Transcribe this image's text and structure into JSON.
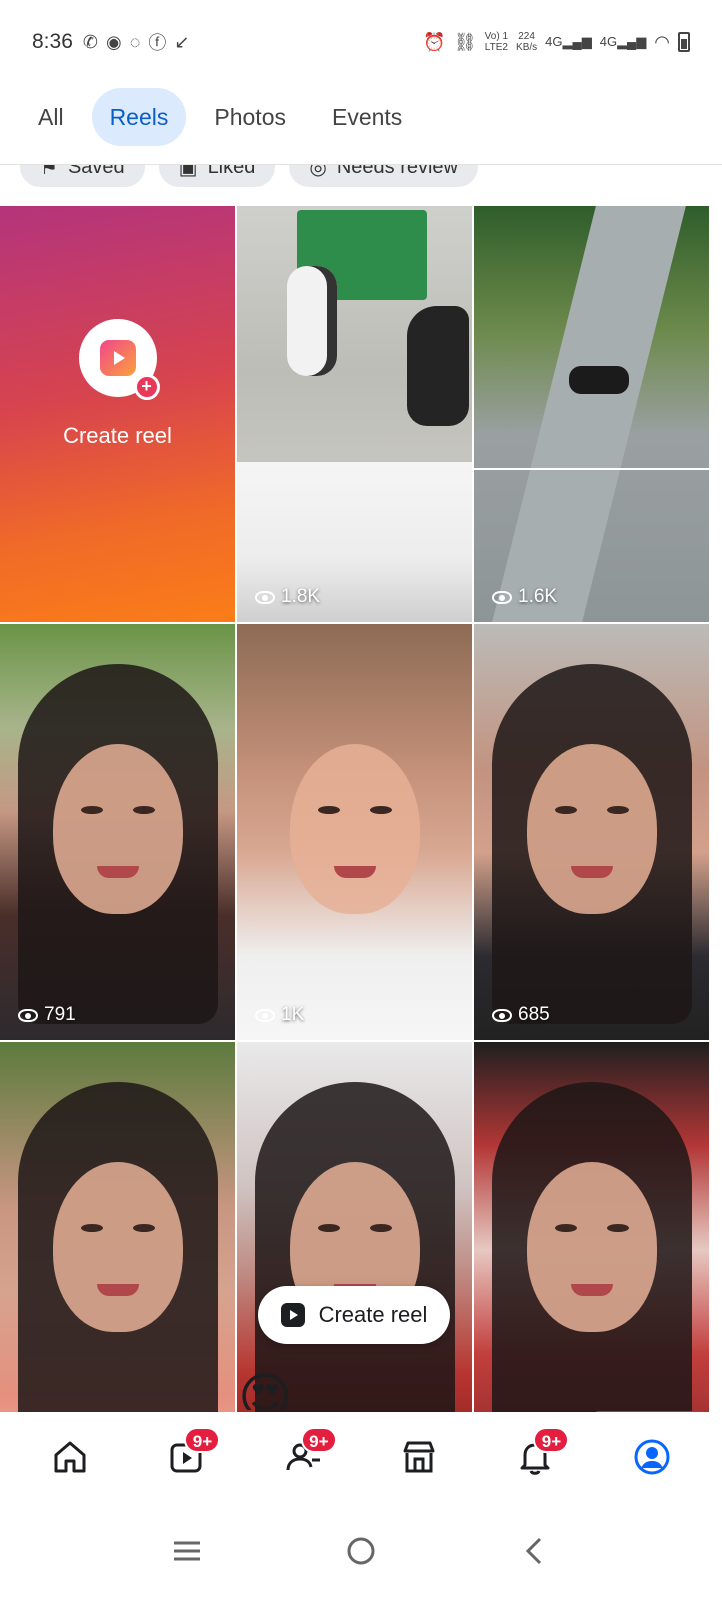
{
  "status_bar": {
    "time": "8:36",
    "left_icons": [
      "phone-icon",
      "messenger-icon",
      "whatsapp-icon",
      "facebook-icon",
      "missed-call-icon"
    ],
    "network_labels": [
      "Vo) 1",
      "LTE2"
    ],
    "speed": "224",
    "speed_unit": "KB/s",
    "signal_labels": [
      "4G",
      "4G"
    ]
  },
  "tabs": [
    {
      "label": "All",
      "active": false
    },
    {
      "label": "Reels",
      "active": true
    },
    {
      "label": "Photos",
      "active": false
    },
    {
      "label": "Events",
      "active": false
    }
  ],
  "chips": [
    "Saved",
    "Liked",
    "Needs review"
  ],
  "create_tile": {
    "label": "Create reel"
  },
  "tiles": [
    {
      "kind": "video",
      "views": "1.8K"
    },
    {
      "kind": "video",
      "views": "1.6K"
    },
    {
      "kind": "video",
      "views": "791"
    },
    {
      "kind": "video",
      "views": "1K"
    },
    {
      "kind": "video",
      "views": "685"
    },
    {
      "kind": "video",
      "views": ""
    },
    {
      "kind": "video",
      "views": ""
    },
    {
      "kind": "video",
      "views": ""
    }
  ],
  "create_pill": {
    "label": "Create reel"
  },
  "bottom_nav": {
    "items": [
      {
        "name": "home",
        "badge": ""
      },
      {
        "name": "video",
        "badge": "9+"
      },
      {
        "name": "friends",
        "badge": "9+"
      },
      {
        "name": "marketplace",
        "badge": ""
      },
      {
        "name": "notifications",
        "badge": "9+"
      },
      {
        "name": "profile",
        "badge": ""
      }
    ],
    "active_color": "#0866ff",
    "badge_color": "#e41e3f"
  },
  "colors": {
    "tab_active_bg": "#dbeafc",
    "tab_active_text": "#0a5fc6",
    "create_gradient": [
      "#b4347c",
      "#fb7d18"
    ]
  }
}
